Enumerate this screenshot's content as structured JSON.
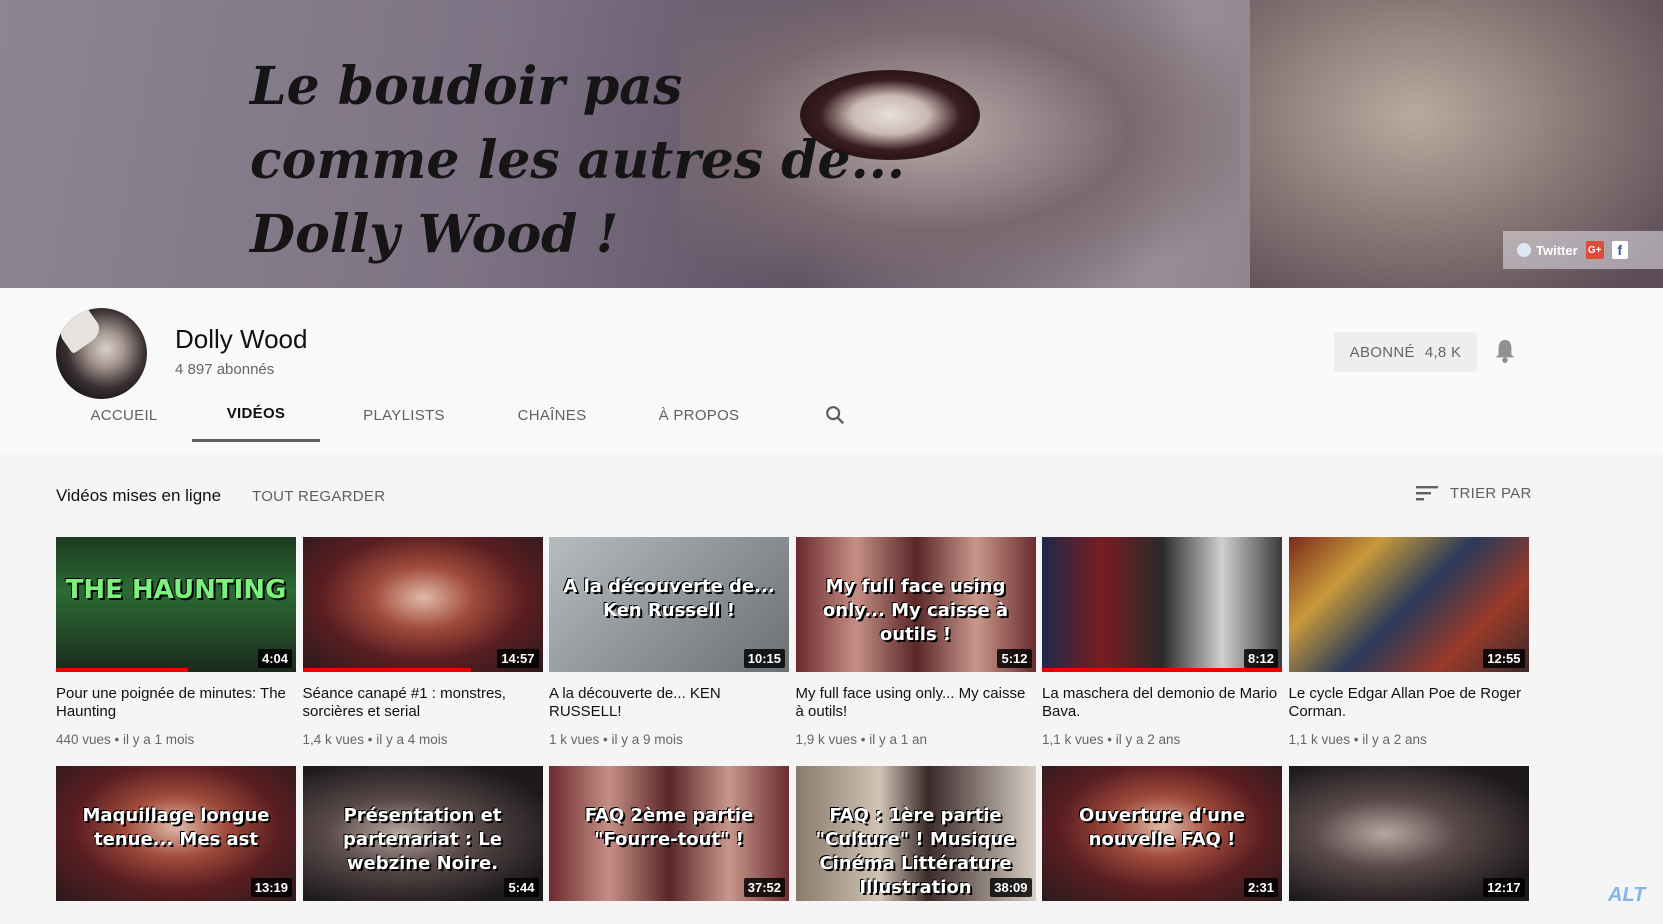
{
  "banner": {
    "quote_lines": [
      "Le boudoir pas",
      "comme les autres de...",
      "Dolly Wood !"
    ],
    "social": {
      "twitter_label": "Twitter",
      "gplus_label": "G+",
      "facebook_label": "f"
    }
  },
  "channel": {
    "name": "Dolly Wood",
    "subscribers": "4 897 abonnés",
    "subscribe_label": "ABONNÉ",
    "subscribe_count": "4,8 K"
  },
  "tabs": [
    "ACCUEIL",
    "VIDÉOS",
    "PLAYLISTS",
    "CHAÎNES",
    "À PROPOS"
  ],
  "active_tab": "VIDÉOS",
  "section": {
    "title": "Vidéos mises en ligne",
    "play_all": "TOUT REGARDER",
    "sort_label": "TRIER PAR"
  },
  "videos": [
    {
      "title": "Pour une poignée de minutes: The Haunting",
      "meta": "440 vues • il y a 1 mois",
      "duration": "4:04",
      "overlay": "THE HAUNTING",
      "watched": 0.55,
      "palette": "green"
    },
    {
      "title": "Séance canapé #1 : monstres, sorcières et serial",
      "meta": "1,4 k vues • il y a 4 mois",
      "duration": "14:57",
      "overlay": "",
      "watched": 0.7,
      "palette": "redhair"
    },
    {
      "title": "A la découverte de... KEN RUSSELL!",
      "meta": "1 k vues • il y a 9 mois",
      "duration": "10:15",
      "overlay": "A la découverte de... Ken Russell !",
      "watched": 0,
      "palette": "grey"
    },
    {
      "title": "My full face using only... My caisse à outils!",
      "meta": "1,9 k vues • il y a 1 an",
      "duration": "5:12",
      "overlay": "My full face using only... My caisse à outils !",
      "watched": 0,
      "palette": "faces"
    },
    {
      "title": "La maschera del demonio de Mario Bava.",
      "meta": "1,1 k vues • il y a 2 ans",
      "duration": "8:12",
      "overlay": "",
      "watched": 1,
      "palette": "mask"
    },
    {
      "title": "Le cycle Edgar Allan Poe de Roger Corman.",
      "meta": "1,1 k vues • il y a 2 ans",
      "duration": "12:55",
      "overlay": "",
      "watched": 0,
      "palette": "posters"
    },
    {
      "title": "",
      "meta": "",
      "duration": "13:19",
      "overlay": "Maquillage longue tenue... Mes ast",
      "watched": 0,
      "palette": "redhair"
    },
    {
      "title": "",
      "meta": "",
      "duration": "5:44",
      "overlay": "Présentation et partenariat : Le webzine Noire.",
      "watched": 0,
      "palette": "dark"
    },
    {
      "title": "",
      "meta": "",
      "duration": "37:52",
      "overlay": "FAQ 2ème partie \"Fourre-tout\" !",
      "watched": 0,
      "palette": "faces"
    },
    {
      "title": "",
      "meta": "",
      "duration": "38:09",
      "overlay": "FAQ : 1ère partie \"Culture\" ! Musique Cinéma Littérature Illustration",
      "watched": 0,
      "palette": "room"
    },
    {
      "title": "",
      "meta": "",
      "duration": "2:31",
      "overlay": "Ouverture d'une nouvelle FAQ !",
      "watched": 0,
      "palette": "redhair"
    },
    {
      "title": "",
      "meta": "",
      "duration": "12:17",
      "overlay": "",
      "watched": 0,
      "palette": "dark"
    }
  ],
  "watermark": "ALT"
}
